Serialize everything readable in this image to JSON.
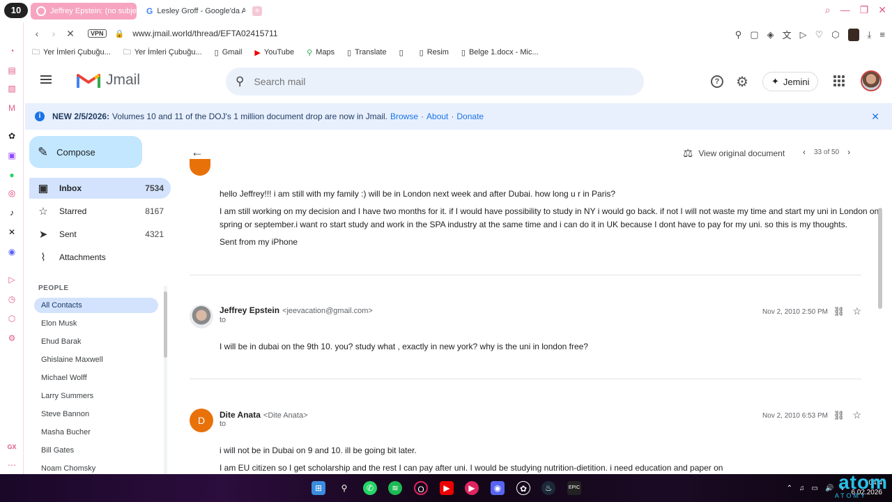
{
  "browser": {
    "logo_badge": "10",
    "tabs": [
      {
        "title": "Jeffrey Epstein: (no subje"
      },
      {
        "title": "Lesley Groff - Google'da A"
      }
    ],
    "new_tab": "+",
    "url": "www.jmail.world/thread/EFTA02415711",
    "vpn_label": "VPN",
    "bookmarks": [
      {
        "label": "Yer İmleri Çubuğu...",
        "icon": "folder-icon"
      },
      {
        "label": "Yer İmleri Çubuğu...",
        "icon": "folder-icon"
      },
      {
        "label": "Gmail",
        "icon": "page-icon"
      },
      {
        "label": "YouTube",
        "icon": "youtube-icon"
      },
      {
        "label": "Maps",
        "icon": "maps-pin-icon"
      },
      {
        "label": "Translate",
        "icon": "page-icon"
      },
      {
        "label": "",
        "icon": "page-icon"
      },
      {
        "label": "Resim",
        "icon": "page-icon"
      },
      {
        "label": "Belge 1.docx - Mic...",
        "icon": "page-icon"
      }
    ]
  },
  "app": {
    "name": "Jmail",
    "search_placeholder": "Search mail",
    "jemini_label": "Jemini"
  },
  "banner": {
    "bold": "NEW 2/5/2026:",
    "text": "Volumes 10 and 11 of the DOJ's 1 million document drop are now in Jmail.",
    "links": [
      "Browse",
      "About",
      "Donate"
    ],
    "separator": "·"
  },
  "sidebar": {
    "compose": "Compose",
    "items": [
      {
        "label": "Inbox",
        "count": "7534",
        "icon": "inbox-icon"
      },
      {
        "label": "Starred",
        "count": "8167",
        "icon": "star-icon"
      },
      {
        "label": "Sent",
        "count": "4321",
        "icon": "send-icon"
      },
      {
        "label": "Attachments",
        "count": "",
        "icon": "paperclip-icon"
      }
    ],
    "people_heading": "PEOPLE",
    "contacts": [
      "All Contacts",
      "Elon Musk",
      "Ehud Barak",
      "Ghislaine Maxwell",
      "Michael Wolff",
      "Larry Summers",
      "Steve Bannon",
      "Masha Bucher",
      "Bill Gates",
      "Noam Chomsky"
    ]
  },
  "thread": {
    "view_original": "View original document",
    "pager": "33 of 50",
    "first_message": {
      "paragraphs": [
        "hello Jeffrey!!! i am still with my family :) will be in London next week and after Dubai. how long u r in Paris?",
        "I am still working on my decision and I have two months for it. if I would have possibility to study in NY i would go back. if not I will not waste my time and start my uni in London on",
        "spring or september.i want ro start study and work in the SPA industry at the same time and i can do it in UK because I dont have to pay for my uni. so this is my thoughts.",
        "Sent from my iPhone"
      ]
    },
    "messages": [
      {
        "sender": "Jeffrey Epstein",
        "email": "<jeevacation@gmail.com>",
        "to": "to",
        "date": "Nov 2, 2010 2:50 PM",
        "body": [
          "I will be in dubai on the 9th 10. you? study what , exactly in new york? why is the uni in london free?"
        ]
      },
      {
        "sender": "Dite Anata",
        "initial": "D",
        "email": "<Dite Anata>",
        "to": "to",
        "date": "Nov 2, 2010 6:53 PM",
        "body": [
          "i will not be in Dubai on 9 and 10. ill be going bit later.",
          "I am EU citizen so I get scholarship and the rest I can pay after uni. I would be studying nutrition-dietition. i need education and paper on"
        ]
      }
    ]
  },
  "taskbar": {
    "time": "04:4",
    "date": "6.02.2026",
    "watermark": "atom",
    "watermark_sub": "ATOMY"
  },
  "colors": {
    "accent": "#1a73e8",
    "compose_bg": "#c2e7ff",
    "active_nav": "#d3e3fd",
    "banner_bg": "#e8f0fe",
    "opera_tab": "#f6a4bf",
    "avatar_orange": "#e8710a"
  }
}
